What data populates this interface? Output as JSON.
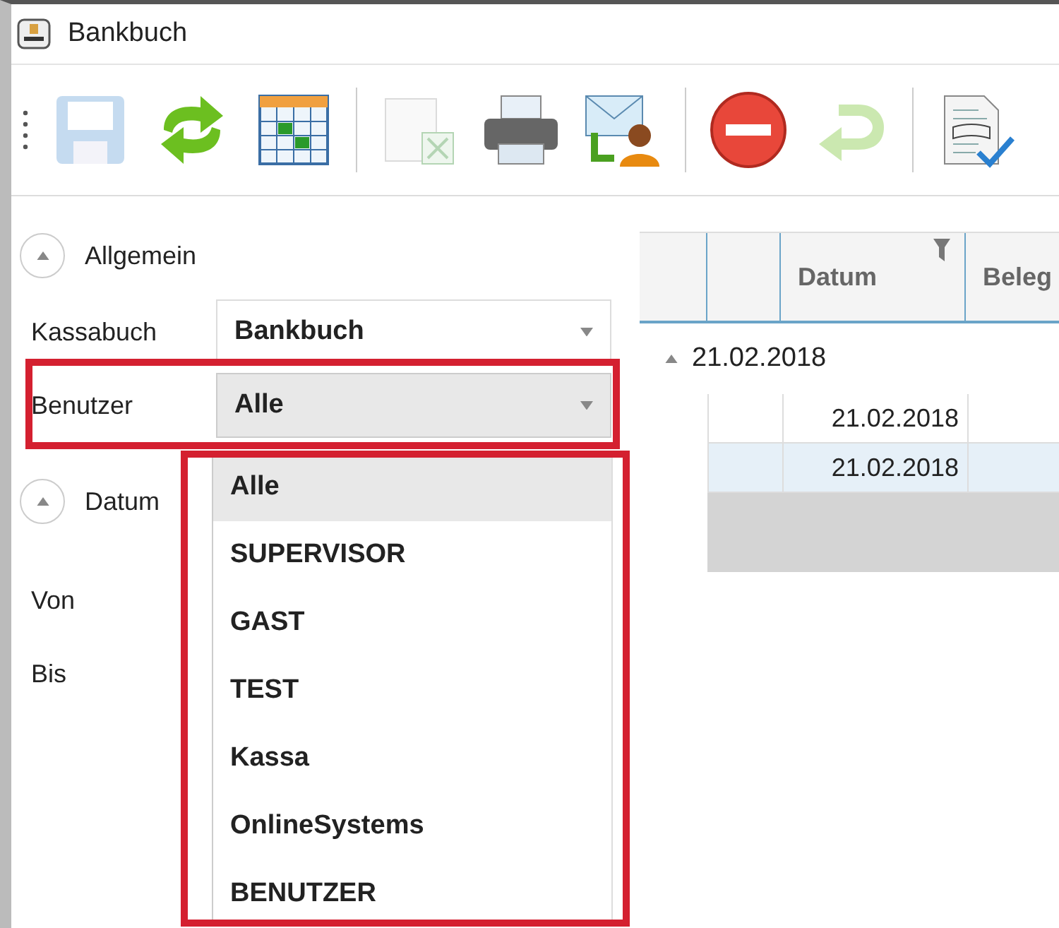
{
  "window": {
    "title": "Bankbuch"
  },
  "toolbar": {
    "buttons": [
      {
        "kind": "save",
        "disabled": true
      },
      {
        "kind": "refresh",
        "disabled": false
      },
      {
        "kind": "calendar",
        "disabled": false
      },
      {
        "kind": "separator"
      },
      {
        "kind": "export",
        "disabled": true
      },
      {
        "kind": "print",
        "disabled": false
      },
      {
        "kind": "mail",
        "disabled": false
      },
      {
        "kind": "separator"
      },
      {
        "kind": "cancel",
        "disabled": false
      },
      {
        "kind": "undo",
        "disabled": true
      },
      {
        "kind": "separator"
      },
      {
        "kind": "report",
        "disabled": false
      }
    ]
  },
  "sections": [
    {
      "title": "Allgemein",
      "expanded": true,
      "fields": [
        {
          "label": "Kassabuch",
          "value": "Bankbuch",
          "kind": "combo",
          "open": false
        },
        {
          "label": "Benutzer",
          "value": "Alle",
          "kind": "combo",
          "open": true
        }
      ]
    },
    {
      "title": "Datum",
      "expanded": true,
      "fields": [
        {
          "label": "Von",
          "kind": "label"
        },
        {
          "label": "Bis",
          "kind": "label"
        }
      ]
    }
  ],
  "dropdown": {
    "options": [
      {
        "label": "Alle",
        "selected": true
      },
      {
        "label": "SUPERVISOR",
        "selected": false
      },
      {
        "label": "GAST",
        "selected": false
      },
      {
        "label": "TEST",
        "selected": false
      },
      {
        "label": "Kassa",
        "selected": false
      },
      {
        "label": "OnlineSystems",
        "selected": false
      },
      {
        "label": "BENUTZER",
        "selected": false
      }
    ]
  },
  "grid": {
    "columns": [
      {
        "filter": false
      },
      {
        "filter": false
      },
      {
        "label": "Datum",
        "filter": true
      },
      {
        "label": "Beleg",
        "filter": false
      }
    ],
    "groups": [
      {
        "title": "21.02.2018",
        "expanded": true,
        "rows": [
          {
            "date": "21.02.2018",
            "selected": false
          },
          {
            "date": "21.02.2018",
            "selected": true
          }
        ]
      }
    ]
  }
}
